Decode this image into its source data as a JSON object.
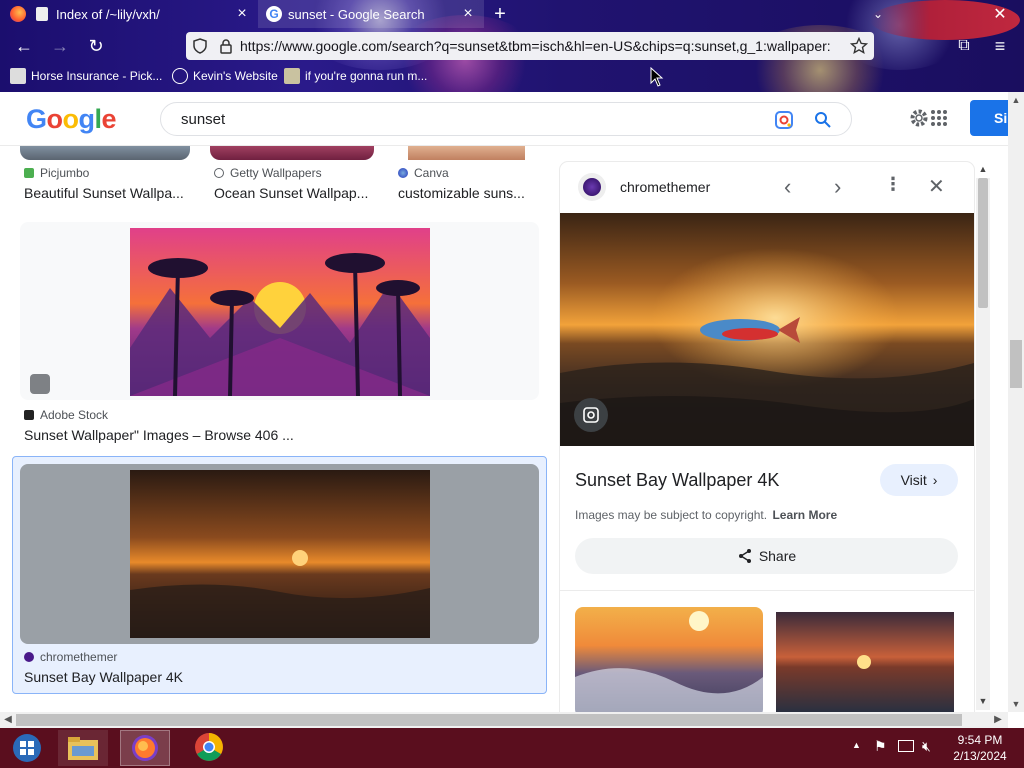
{
  "browser": {
    "tabs": [
      {
        "title": "Index of /~lily/vxh/",
        "active": false
      },
      {
        "title": "sunset - Google Search",
        "active": true
      }
    ],
    "new_tab_label": "+",
    "url": "https://www.google.com/search?q=sunset&tbm=isch&hl=en-US&chips=q:sunset,g_1:wallpaper:",
    "bookmarks": [
      {
        "label": "Horse Insurance - Pick...",
        "icon": "star-icon"
      },
      {
        "label": "Kevin's Website",
        "icon": "globe-icon"
      },
      {
        "label": "if you're gonna run m...",
        "icon": "avatar-icon"
      }
    ]
  },
  "google": {
    "logo_letters": [
      {
        "char": "G",
        "color": "#4285F4"
      },
      {
        "char": "o",
        "color": "#EA4335"
      },
      {
        "char": "o",
        "color": "#FBBC05"
      },
      {
        "char": "g",
        "color": "#4285F4"
      },
      {
        "char": "l",
        "color": "#34A853"
      },
      {
        "char": "e",
        "color": "#EA4335"
      }
    ],
    "query": "sunset",
    "sign_in_label": "Si"
  },
  "results": {
    "top_row": [
      {
        "source": "Picjumbo",
        "title": "Beautiful Sunset Wallpa..."
      },
      {
        "source": "Getty Wallpapers",
        "title": "Ocean Sunset Wallpap..."
      },
      {
        "source": "Canva",
        "title": "customizable suns..."
      }
    ],
    "middle": {
      "source": "Adobe Stock",
      "title": "Sunset Wallpaper\" Images – Browse 406 ..."
    },
    "bottom": {
      "source": "chromethemer",
      "title": "Sunset Bay Wallpaper 4K"
    }
  },
  "panel": {
    "source": "chromethemer",
    "title": "Sunset Bay Wallpaper 4K",
    "visit_label": "Visit",
    "copyright_text": "Images may be subject to copyright.",
    "learn_more": "Learn More",
    "share_label": "Share"
  },
  "taskbar": {
    "time": "9:54 PM",
    "date": "2/13/2024"
  },
  "colors": {
    "accent_blue": "#1a73e8",
    "selected_border": "#8ab4f8",
    "selected_bg": "#e8f0fe",
    "taskbar": "#5a0e1e"
  }
}
